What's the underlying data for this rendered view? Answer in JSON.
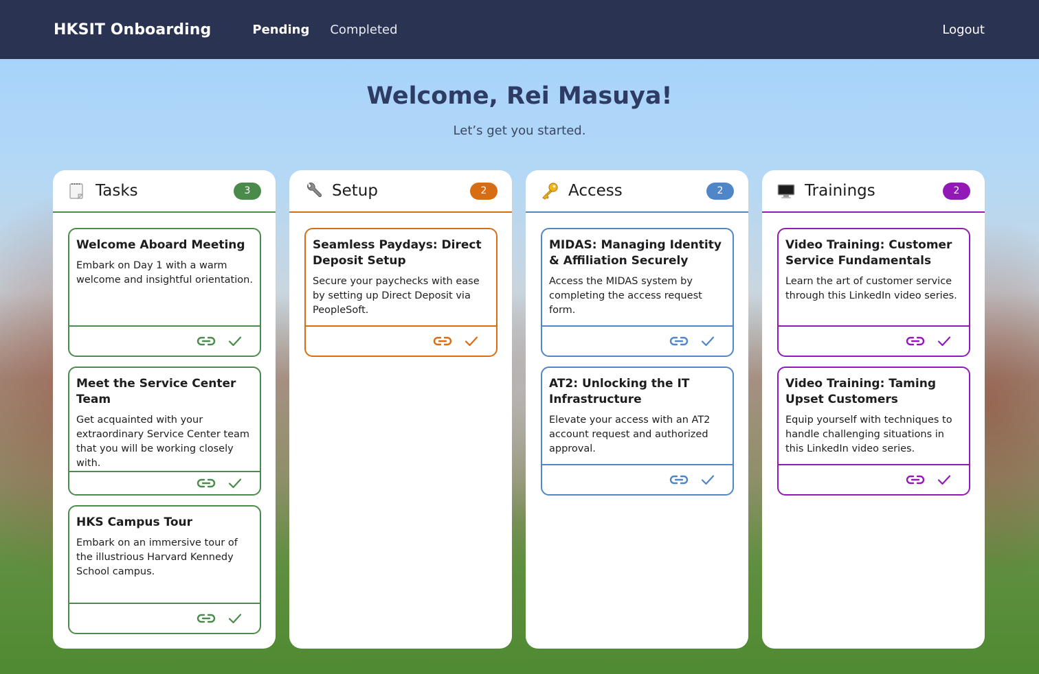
{
  "app": {
    "brand": "HKSIT Onboarding",
    "nav": [
      {
        "label": "Pending",
        "active": true
      },
      {
        "label": "Completed",
        "active": false
      }
    ],
    "logout": "Logout"
  },
  "hero": {
    "title": "Welcome, Rei Masuya!",
    "subtitle": "Let’s get you started."
  },
  "colors": {
    "topbar": "#2a3352",
    "tasks": "#4a8a4a",
    "setup": "#d86c12",
    "access": "#4e86c7",
    "trainings": "#9219b8"
  },
  "columns": [
    {
      "key": "tasks",
      "icon": "notepad-icon",
      "title": "Tasks",
      "count": "3",
      "cards": [
        {
          "title": "Welcome Aboard Meeting",
          "desc": "Embark on Day 1 with a warm welcome and insightful orientation."
        },
        {
          "title": "Meet the Service Center Team",
          "desc": "Get acquainted with your extraordinary Service Center team that you will be working closely with."
        },
        {
          "title": "HKS Campus Tour",
          "desc": "Embark on an immersive tour of the illustrious Harvard Kennedy School campus."
        }
      ]
    },
    {
      "key": "setup",
      "icon": "wrench-icon",
      "title": "Setup",
      "count": "2",
      "cards": [
        {
          "title": "Seamless Paydays: Direct Deposit Setup",
          "desc": "Secure your paychecks with ease by setting up Direct Deposit via PeopleSoft."
        }
      ]
    },
    {
      "key": "access",
      "icon": "key-icon",
      "title": "Access",
      "count": "2",
      "cards": [
        {
          "title": "MIDAS: Managing Identity & Affiliation Securely",
          "desc": "Access the MIDAS system by completing the access request form."
        },
        {
          "title": "AT2: Unlocking the IT Infrastructure",
          "desc": "Elevate your access with an AT2 account request and authorized approval."
        }
      ]
    },
    {
      "key": "trainings",
      "icon": "computer-icon",
      "title": "Trainings",
      "count": "2",
      "cards": [
        {
          "title": "Video Training: Customer Service Fundamentals",
          "desc": "Learn the art of customer service through this LinkedIn video series."
        },
        {
          "title": "Video Training: Taming Upset Customers",
          "desc": "Equip yourself with techniques to handle challenging situations in this LinkedIn video series."
        }
      ]
    }
  ]
}
